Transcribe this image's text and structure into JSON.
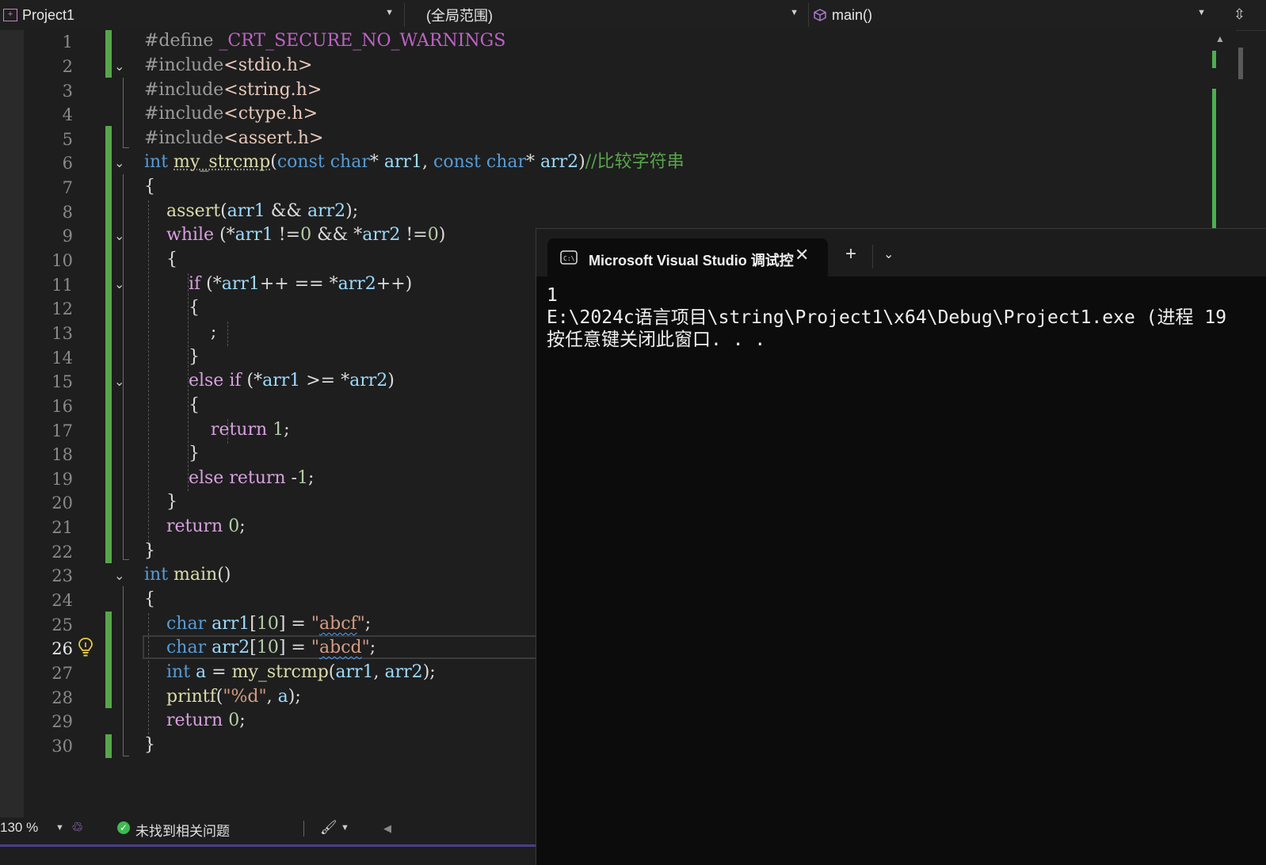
{
  "navbar": {
    "project": "Project1",
    "scope": "(全局范围)",
    "member": "main()"
  },
  "editor": {
    "line_numbers": [
      "1",
      "2",
      "3",
      "4",
      "5",
      "6",
      "7",
      "8",
      "9",
      "10",
      "11",
      "12",
      "13",
      "14",
      "15",
      "16",
      "17",
      "18",
      "19",
      "20",
      "21",
      "22",
      "23",
      "24",
      "25",
      "26",
      "27",
      "28",
      "29",
      "30"
    ],
    "current_line": "26",
    "lines": [
      "#define _CRT_SECURE_NO_WARNINGS",
      "#include<stdio.h>",
      "#include<string.h>",
      "#include<ctype.h>",
      "#include<assert.h>",
      "int my_strcmp(const char* arr1, const char* arr2)//比较字符串",
      "{",
      "    assert(arr1 && arr2);",
      "    while (*arr1 !=0 && *arr2 !=0)",
      "    {",
      "        if (*arr1++ == *arr2++)",
      "        {",
      "            ;",
      "        }",
      "        else if (*arr1 >= *arr2)",
      "        {",
      "            return 1;",
      "        }",
      "        else return -1;",
      "    }",
      "    return 0;",
      "}",
      "int main()",
      "{",
      "    char arr1[10] = \"abcf\";",
      "    char arr2[10] = \"abcd\";",
      "    int a = my_strcmp(arr1, arr2);",
      "    printf(\"%d\", a);",
      "    return 0;",
      "}"
    ]
  },
  "status": {
    "zoom": "130 %",
    "issues": "未找到相关问题"
  },
  "console": {
    "tab_title": "Microsoft Visual Studio 调试控",
    "output": [
      "1",
      "E:\\2024c语言项目\\string\\Project1\\x64\\Debug\\Project1.exe (进程 19",
      "按任意键关闭此窗口. . ."
    ]
  },
  "colors": {
    "editor_bg": "#1e1e1e",
    "keyword": "#569cd6",
    "control": "#d8a0df",
    "function": "#dcdcaa",
    "comment": "#57a64a",
    "string": "#d69d85",
    "change_bar": "#57a64a",
    "console_bg": "#0c0c0c"
  },
  "icons": [
    "project-icon",
    "member-cube-icon",
    "split-window-icon",
    "lightbulb-icon",
    "check-circle-icon",
    "brush-icon",
    "terminal-icon",
    "close-icon",
    "plus-icon",
    "chevron-down-icon"
  ]
}
